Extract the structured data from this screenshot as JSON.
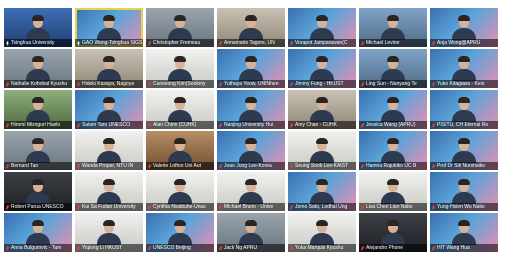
{
  "gallery": {
    "participants": [
      {
        "name": "Tsinghua University",
        "bg": "bg-blue",
        "muted": false
      },
      {
        "name": "GAO Wang-Tsinghua SIGS",
        "bg": "bg-banner",
        "muted": false,
        "speaking": true
      },
      {
        "name": "Christopher Fremeau",
        "bg": "bg-wall",
        "muted": true
      },
      {
        "name": "Annamarie Tagore, UN",
        "bg": "bg-office",
        "muted": true
      },
      {
        "name": "Vorapot Jamparawan(C",
        "bg": "bg-banner",
        "muted": true
      },
      {
        "name": "Michael Levine",
        "bg": "bg-city",
        "muted": true
      },
      {
        "name": "Anja Wong@APRU",
        "bg": "bg-banner",
        "muted": true
      },
      {
        "name": "Nathalie Kohobal Kyushu",
        "bg": "bg-wall",
        "muted": true
      },
      {
        "name": "Hideki Kasaya, Nagoya",
        "bg": "bg-office",
        "muted": true
      },
      {
        "name": "Cunseong Kim(Sookmy",
        "bg": "bg-white",
        "muted": true
      },
      {
        "name": "Yuthaya Yeow, UNINhen",
        "bg": "bg-banner",
        "muted": true
      },
      {
        "name": "Jimmy Fung - HKUST",
        "bg": "bg-banner",
        "muted": true
      },
      {
        "name": "Ling Sun - Nanyang Te",
        "bg": "bg-city",
        "muted": true
      },
      {
        "name": "Yuko Kitagawa - Keio",
        "bg": "bg-banner",
        "muted": true
      },
      {
        "name": "Hiromi Mizoguri Huelo",
        "bg": "bg-green",
        "muted": true
      },
      {
        "name": "Sulam Taro UNESCO",
        "bg": "bg-banner",
        "muted": true
      },
      {
        "name": "Alan Chinn (CUHK)",
        "bg": "bg-white",
        "muted": true
      },
      {
        "name": "Nanjing University Hui",
        "bg": "bg-banner",
        "muted": true
      },
      {
        "name": "Amy Chan - CUHK",
        "bg": "bg-office",
        "muted": true
      },
      {
        "name": "Jessica Wang (APRU)",
        "bg": "bg-banner",
        "muted": true
      },
      {
        "name": "PIS/TU, CH Eternal Re",
        "bg": "bg-banner",
        "muted": true
      },
      {
        "name": "Bernard Tan",
        "bg": "bg-wall",
        "muted": true
      },
      {
        "name": "Wanda Proper, NTU IN",
        "bg": "bg-white",
        "muted": true
      },
      {
        "name": "Valerie Lofton Uni Aut",
        "bg": "bg-wood",
        "muted": true
      },
      {
        "name": "Joao Jung Lee-Korea",
        "bg": "bg-banner",
        "muted": true
      },
      {
        "name": "Seung Sook Lee-KAIST",
        "bg": "bg-white",
        "muted": true
      },
      {
        "name": "Hamna Rajubiko UC B",
        "bg": "bg-banner",
        "muted": true
      },
      {
        "name": "Prof Dr Siti Nurshaitie",
        "bg": "bg-banner",
        "muted": true
      },
      {
        "name": "Robert Parua UNESCO",
        "bg": "bg-dark",
        "muted": true
      },
      {
        "name": "Kui Sa Fudan University",
        "bg": "bg-white",
        "muted": true
      },
      {
        "name": "Cynthia Nwabuhe-Unus",
        "bg": "bg-white",
        "muted": true
      },
      {
        "name": "Michael Bruno - Unive",
        "bg": "bg-white",
        "muted": true
      },
      {
        "name": "Jomo Sato, Lodhal Ung",
        "bg": "bg-banner",
        "muted": true
      },
      {
        "name": "Lisa Chen Lian Natio",
        "bg": "bg-white",
        "muted": true
      },
      {
        "name": "Yung-Hsien Wu Natio",
        "bg": "bg-banner",
        "muted": true
      },
      {
        "name": "Anna Bulgurovic - Tam",
        "bg": "bg-banner",
        "muted": true
      },
      {
        "name": "Yiqiong Li HKUST",
        "bg": "bg-white",
        "muted": true
      },
      {
        "name": "UNESCO Beijing",
        "bg": "bg-banner",
        "muted": true
      },
      {
        "name": "Jack Ng APRU",
        "bg": "bg-wall",
        "muted": true
      },
      {
        "name": "Yuka Marquis Kyushu",
        "bg": "bg-white",
        "muted": true
      },
      {
        "name": "Alejandro Phone",
        "bg": "bg-dark",
        "muted": true
      },
      {
        "name": "HIT Wang Hua",
        "bg": "bg-banner",
        "muted": true
      }
    ]
  },
  "colors": {
    "name_text": "#ffffff",
    "muted_icon": "#e5433d",
    "active_speaker_border": "#e7d24a"
  },
  "icons": {
    "muted": "mic-muted-icon",
    "unmuted": "mic-icon"
  }
}
